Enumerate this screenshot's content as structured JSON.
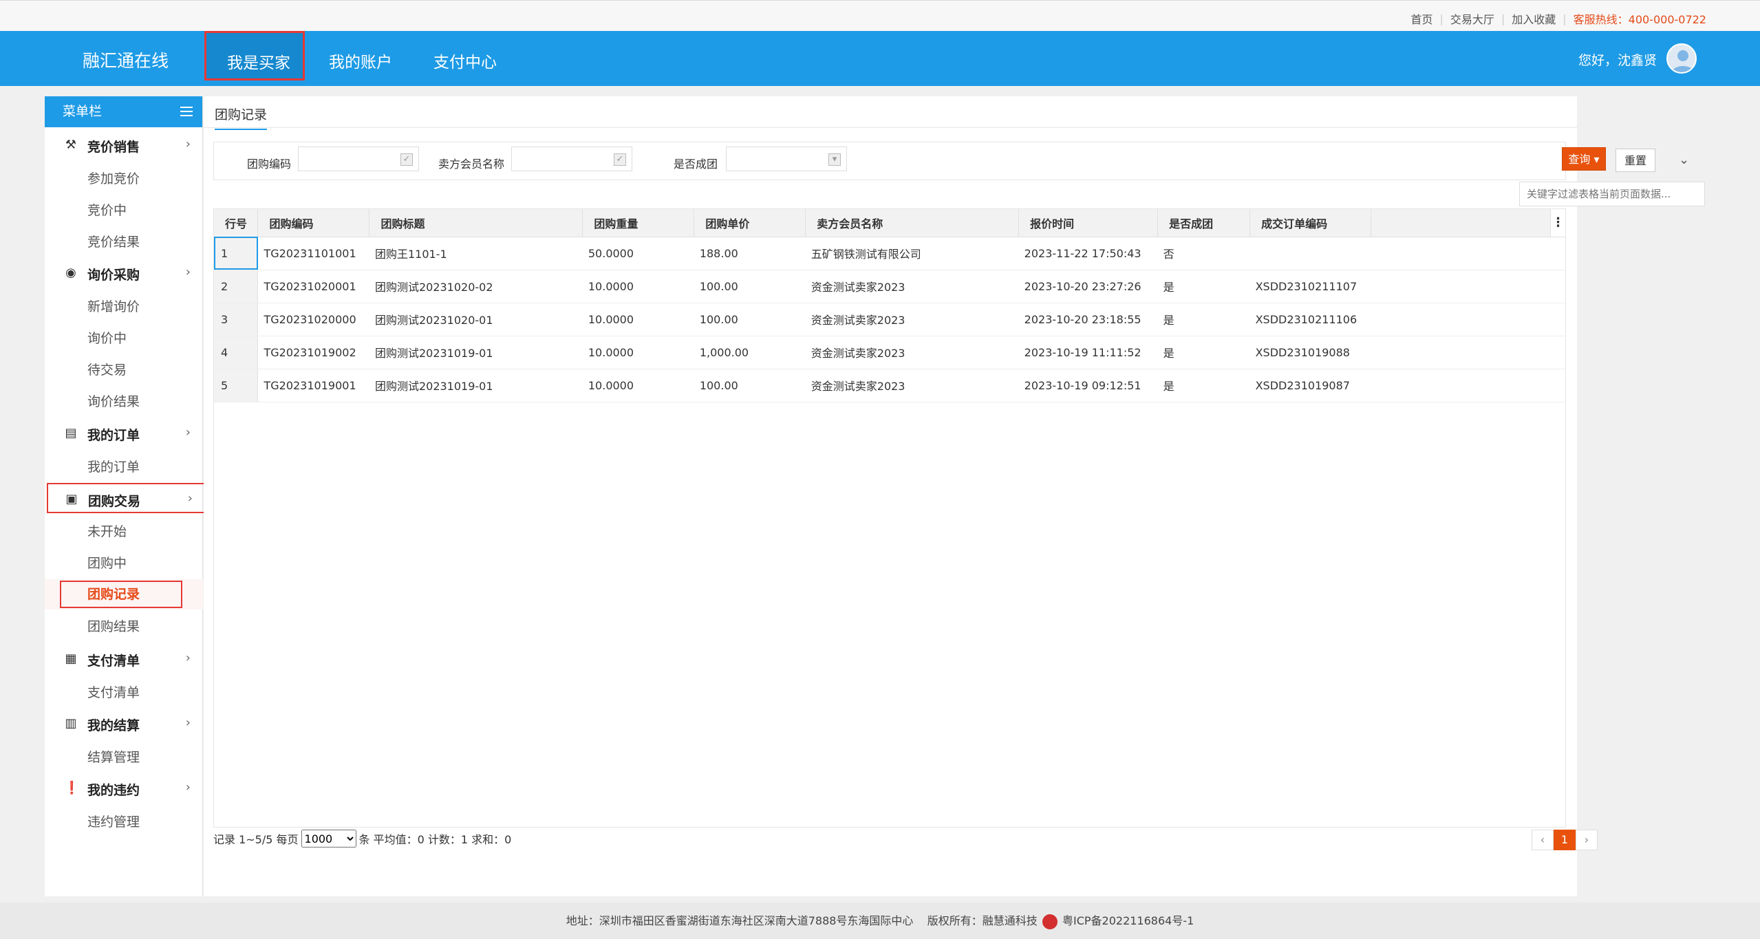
{
  "topbar": {
    "links": [
      "首页",
      "交易大厅",
      "加入收藏"
    ],
    "hotline": "客服热线：400-000-0722"
  },
  "header": {
    "brand": "融汇通在线",
    "nav": [
      "我是买家",
      "我的账户",
      "支付中心"
    ],
    "greeting": "您好，沈鑫贤"
  },
  "sidebar": {
    "title": "菜单栏",
    "groups": [
      {
        "label": "竞价销售",
        "icon": "gavel-icon",
        "items": [
          "参加竞价",
          "竞价中",
          "竞价结果"
        ]
      },
      {
        "label": "询价采购",
        "icon": "search-circle-icon",
        "items": [
          "新增询价",
          "询价中",
          "待交易",
          "询价结果"
        ]
      },
      {
        "label": "我的订单",
        "icon": "document-icon",
        "items": [
          "我的订单"
        ]
      },
      {
        "label": "团购交易",
        "icon": "shop-icon",
        "items": [
          "未开始",
          "团购中",
          "团购记录",
          "团购结果"
        ]
      },
      {
        "label": "支付清单",
        "icon": "payment-icon",
        "items": [
          "支付清单"
        ]
      },
      {
        "label": "我的结算",
        "icon": "calculator-icon",
        "items": [
          "结算管理"
        ]
      },
      {
        "label": "我的违约",
        "icon": "alert-icon",
        "items": [
          "违约管理"
        ]
      }
    ]
  },
  "main": {
    "tab": "团购记录",
    "filter": {
      "code_label": "团购编码",
      "seller_label": "卖方会员名称",
      "grouped_label": "是否成团",
      "query": "查询",
      "reset": "重置",
      "keyword_placeholder": "关键字过滤表格当前页面数据..."
    },
    "table": {
      "headers": [
        "行号",
        "团购编码",
        "团购标题",
        "团购重量",
        "团购单价",
        "卖方会员名称",
        "报价时间",
        "是否成团",
        "成交订单编码"
      ],
      "rows": [
        [
          "1",
          "TG20231101001",
          "团购王1101-1",
          "50.0000",
          "188.00",
          "五矿钢铁测试有限公司",
          "2023-11-22 17:50:43",
          "否",
          ""
        ],
        [
          "2",
          "TG20231020001",
          "团购测试20231020-02",
          "10.0000",
          "100.00",
          "资金测试卖家2023",
          "2023-10-20 23:27:26",
          "是",
          "XSDD2310211107"
        ],
        [
          "3",
          "TG20231020000",
          "团购测试20231020-01",
          "10.0000",
          "100.00",
          "资金测试卖家2023",
          "2023-10-20 23:18:55",
          "是",
          "XSDD2310211106"
        ],
        [
          "4",
          "TG20231019002",
          "团购测试20231019-01",
          "10.0000",
          "1,000.00",
          "资金测试卖家2023",
          "2023-10-19 11:11:52",
          "是",
          "XSDD231019088"
        ],
        [
          "5",
          "TG20231019001",
          "团购测试20231019-01",
          "10.0000",
          "100.00",
          "资金测试卖家2023",
          "2023-10-19 09:12:51",
          "是",
          "XSDD231019087"
        ]
      ]
    },
    "pager": {
      "prefix": "记录 1~5/5 每页",
      "page_size": "1000",
      "suffix": "条 平均值：0 计数：1 求和：0",
      "prev": "‹",
      "current": "1",
      "next": "›"
    }
  },
  "footer": {
    "address": "地址：深圳市福田区香蜜湖街道东海社区深南大道7888号东海国际中心",
    "copyright": "版权所有：融慧通科技",
    "icp": "粤ICP备2022116864号-1"
  },
  "colors": {
    "primary": "#1e9be6",
    "accent": "#e8520c",
    "highlight": "#e53935"
  }
}
